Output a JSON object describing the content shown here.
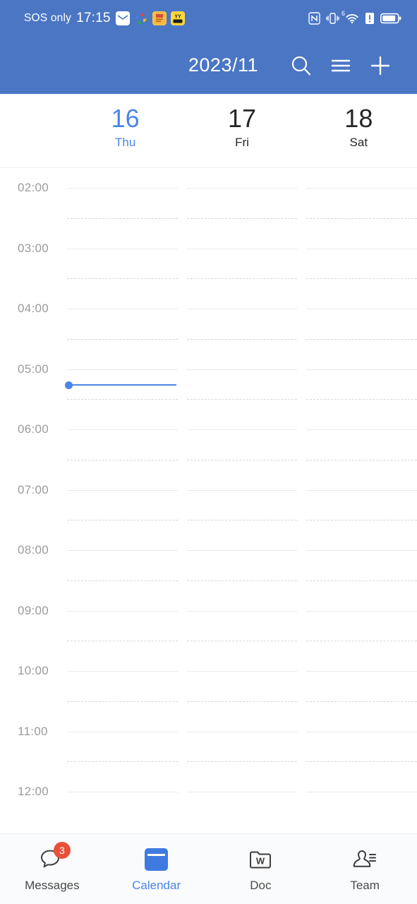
{
  "status_bar": {
    "carrier": "SOS only",
    "time": "17:15",
    "app_icons": [
      {
        "name": "mail-icon",
        "glyph": ""
      },
      {
        "name": "photos-icon",
        "glyph": ""
      },
      {
        "name": "app-icon-orange",
        "glyph": "☰"
      },
      {
        "name": "app-icon-yellow",
        "glyph": "YY"
      }
    ],
    "right_icons": [
      "nfc-icon",
      "vibrate-icon",
      "wifi-6-icon",
      "alert-icon",
      "battery-icon"
    ],
    "wifi_generation": "6"
  },
  "toolbar": {
    "title": "2023/11",
    "search_label": "search-icon",
    "menu_label": "menu-icon",
    "add_label": "add-icon"
  },
  "day_header": {
    "days": [
      {
        "num": "16",
        "name": "Thu",
        "today": true
      },
      {
        "num": "17",
        "name": "Fri",
        "today": false
      },
      {
        "num": "18",
        "name": "Sat",
        "today": false
      }
    ]
  },
  "grid": {
    "hours": [
      "02:00",
      "03:00",
      "04:00",
      "05:00",
      "06:00",
      "07:00",
      "08:00",
      "09:00",
      "10:00",
      "11:00",
      "12:00"
    ],
    "current_time_indicator": {
      "time": "17:15",
      "visual_position_hour": "05:15",
      "column": 0,
      "color": "#4a86e8"
    },
    "events": []
  },
  "bottom_nav": {
    "items": [
      {
        "label": "Messages",
        "icon": "chat-bubble-icon",
        "badge": "3",
        "active": false
      },
      {
        "label": "Calendar",
        "icon": "calendar-icon",
        "badge": "",
        "active": true
      },
      {
        "label": "Doc",
        "icon": "folder-doc-icon",
        "badge": "",
        "active": false
      },
      {
        "label": "Team",
        "icon": "contacts-icon",
        "badge": "",
        "active": false
      }
    ]
  },
  "colors": {
    "header_blue": "#4a76c4",
    "accent_blue": "#4a86e8",
    "badge_red": "#e8503a",
    "text_dark": "#262626",
    "text_muted": "#9b9b9b"
  }
}
